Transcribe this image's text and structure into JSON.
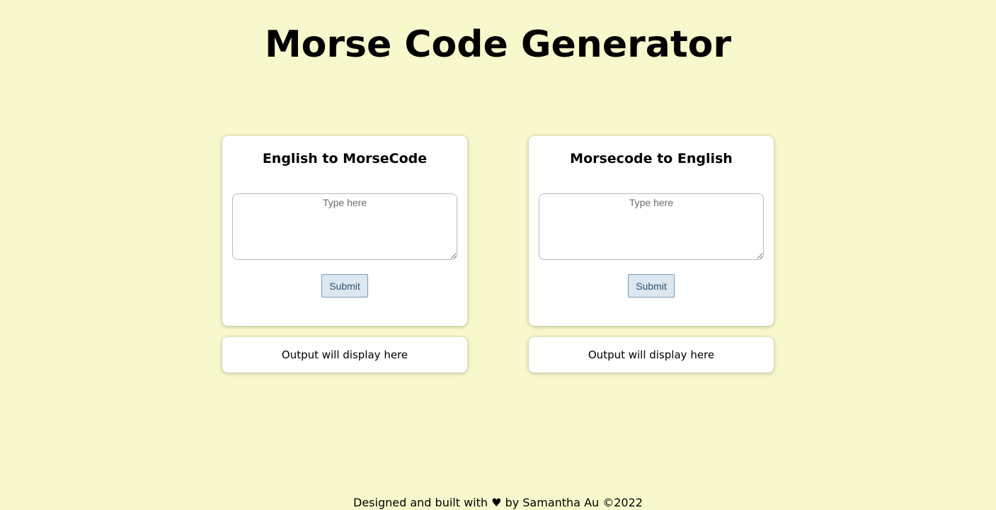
{
  "header": {
    "title": "Morse Code Generator"
  },
  "cards": {
    "english_to_morse": {
      "title": "English to MorseCode",
      "input_placeholder": "Type here",
      "input_value": "",
      "submit_label": "Submit",
      "output_text": "Output will display here"
    },
    "morse_to_english": {
      "title": "Morsecode to English",
      "input_placeholder": "Type here",
      "input_value": "",
      "submit_label": "Submit",
      "output_text": "Output will display here"
    }
  },
  "footer": {
    "prefix": "Designed and built with",
    "icon": "heart-icon",
    "heart_glyph": "♥",
    "suffix": "by Samantha Au ©2022"
  },
  "colors": {
    "background": "#f8f8cd",
    "card": "#ffffff",
    "button_bg": "#dde7f0",
    "button_border": "#7b97b2",
    "button_text": "#2c5577"
  }
}
